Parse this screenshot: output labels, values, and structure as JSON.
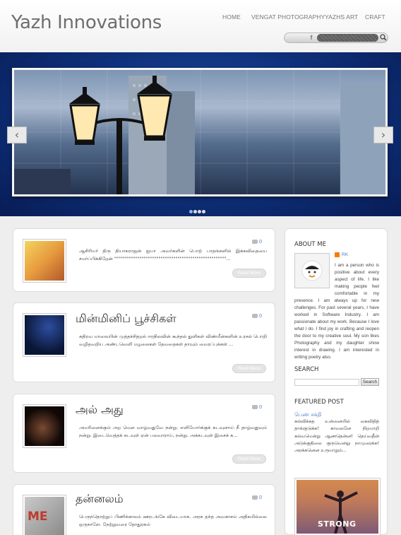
{
  "site": {
    "title": "Yazh Innovations"
  },
  "nav": {
    "items": [
      "HOME",
      "VENGAT PHOTOGRAPHY",
      "YAZHS ART",
      "CRAFT"
    ]
  },
  "header_search": {
    "placeholder": "Search my site...",
    "fb_label": "f"
  },
  "slider": {
    "prev": "‹",
    "next": "›",
    "dot_count": 4,
    "active_dot": 0
  },
  "posts": [
    {
      "title": "",
      "comments": "0",
      "excerpt": "ஆசிரியர் திரு தியாகராஜன் ஐயா அவர்களின் பொற் பாதங்களில் இக்கவிதையை சமர்ப்பிக்கிறேன் \"\"\"\"\"\"\"\"\"\"\"\"\"\"\"\"\"\"\"\"\"\"\"\"\"\"\"\"\"\"\"\"\"\"\"\"\"\"\"\"\"\"\"\"\"\"\"\"\"\"\"\"\"...",
      "read_more": "Read More"
    },
    {
      "title": "மின்மினிப் பூச்சிகள்",
      "comments": "0",
      "excerpt": "கதிரவ மாலையின் முத்தச்சிதறல் ஈரநிலவின் கூந்தல் துளிகள் விண்மீன்களின் உரசல் பொறி வழிதவறிய அண்டவெளி மழலைகள் தேவதைகள் தாவும் வைரப்புக்கள் ...",
      "read_more": "Read More"
    },
    {
      "title": "அல் அது",
      "comments": "0",
      "excerpt": "அமரினைக்கும் அற மென வாழ்வதுவே நன்று. எளியோர்க்குக் கடவுளாய் நீ தாழ்வதுவும் நன்று. இடைவெத்தக் கடவுள் ஏன் பலவாராய், நன்று. அக்கடவுள் இசைக் க...",
      "read_more": "Read More"
    },
    {
      "title": "தன்னலம்",
      "comments": "0",
      "excerpt": "பெருந்தொற்றுப் பிணிக்காலம் ஊரடங்கே விடையாக. அரசு தந்த அவகாசம் அதிகமில்லை ஒருநாளே. நேற்றுவரை தோதுரசும்",
      "read_more": "Read More"
    }
  ],
  "sidebar": {
    "about": {
      "title": "ABOUT ME",
      "name": "RK",
      "text": "I am a person who is positive about every aspect of life. I like making people feel comfortable in my presence. I am always up for new challenges. For past several years, I have worked in Software Industry. I am passionate about my work. Because I love what I do. I find joy in crafting and reopen the door to my creative soul. My son likes Photography and my daughter show interest in drawing. I am interested in writing poetry also."
    },
    "search": {
      "title": "SEARCH",
      "button": "Search"
    },
    "featured": {
      "title": "FEATURED POST",
      "post_title": "பெண் சக்தி",
      "text": "கல்விக்கத உன்னையில் கைவிதித் தாங்குடுக்க! காவலனே நிறமாறி கல்வமென்று ஆணதென்ன! தெய்வதீன் அடுக்குதிலை குருவென்று நாமுரைக்க! அரக்கனென உருமாறும்...",
      "image_caption": "STRONG"
    }
  }
}
